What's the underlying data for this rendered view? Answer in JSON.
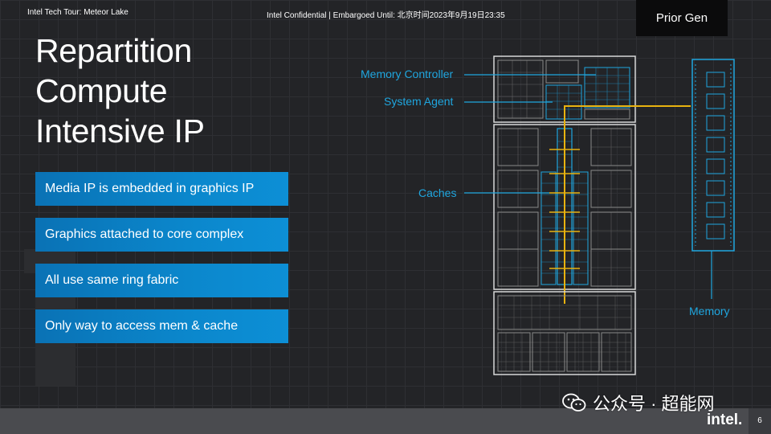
{
  "slide": {
    "title_lines": [
      "Repartition",
      "Compute",
      "Intensive IP"
    ],
    "bullets": [
      "Media IP is embedded in graphics IP",
      "Graphics attached to core complex",
      "All use same ring fabric",
      "Only way to access  mem & cache"
    ],
    "badge": "Prior Gen"
  },
  "diagram": {
    "labels": {
      "memory_controller": "Memory Controller",
      "system_agent": "System Agent",
      "caches": "Caches",
      "memory": "Memory"
    },
    "colors": {
      "accent_blue": "#1fa6df",
      "ring_yellow": "#e8b20f",
      "chip_outline": "#d8d8d8"
    }
  },
  "footer": {
    "left": "Intel Tech Tour: Meteor Lake",
    "middle": "Intel Confidential  |  Embargoed Until: 北京时间2023年9月19日23:35",
    "page": "6",
    "logo": "intel.",
    "watermark": "公众号 · 超能网"
  }
}
